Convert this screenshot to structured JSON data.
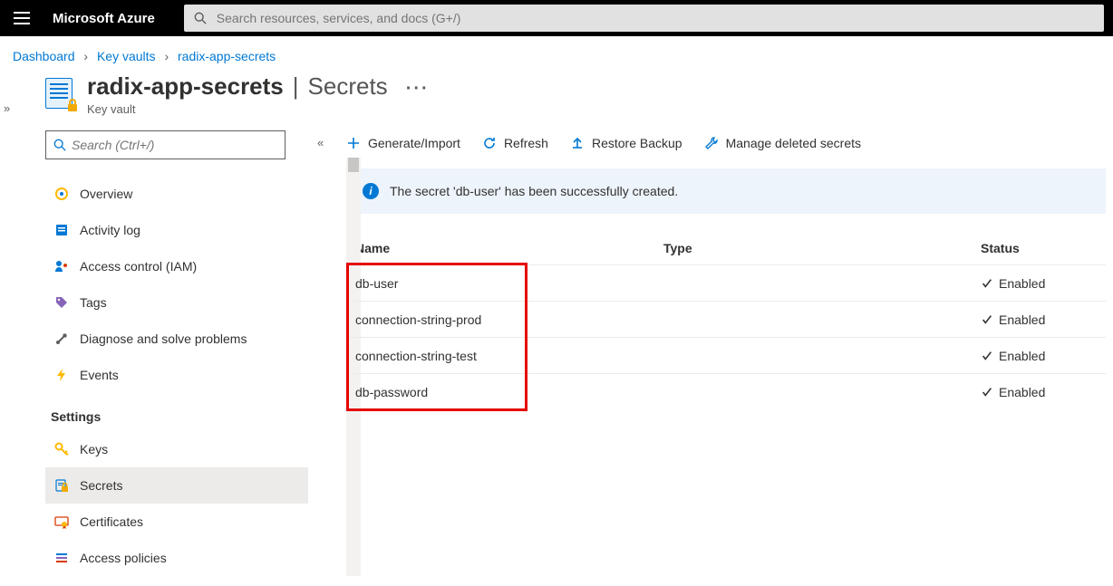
{
  "brand": "Microsoft Azure",
  "search_placeholder": "Search resources, services, and docs (G+/)",
  "breadcrumbs": {
    "dashboard": "Dashboard",
    "keyvaults": "Key vaults",
    "current": "radix-app-secrets"
  },
  "page": {
    "title": "radix-app-secrets",
    "section": "Secrets",
    "subtitle": "Key vault"
  },
  "side_search_placeholder": "Search (Ctrl+/)",
  "nav": {
    "overview": "Overview",
    "activity": "Activity log",
    "iam": "Access control (IAM)",
    "tags": "Tags",
    "diagnose": "Diagnose and solve problems",
    "events": "Events",
    "settings_header": "Settings",
    "keys": "Keys",
    "secrets": "Secrets",
    "certs": "Certificates",
    "policies": "Access policies"
  },
  "toolbar": {
    "generate": "Generate/Import",
    "refresh": "Refresh",
    "restore": "Restore Backup",
    "manage_deleted": "Manage deleted secrets"
  },
  "notice": "The secret 'db-user' has been successfully created.",
  "columns": {
    "name": "Name",
    "type": "Type",
    "status": "Status"
  },
  "rows": [
    {
      "name": "db-user",
      "type": "",
      "status": "Enabled"
    },
    {
      "name": "connection-string-prod",
      "type": "",
      "status": "Enabled"
    },
    {
      "name": "connection-string-test",
      "type": "",
      "status": "Enabled"
    },
    {
      "name": "db-password",
      "type": "",
      "status": "Enabled"
    }
  ]
}
